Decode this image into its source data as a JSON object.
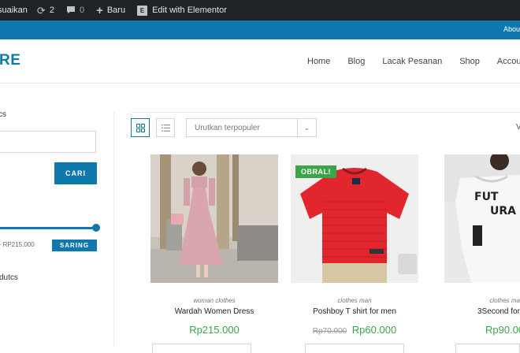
{
  "admin_bar": {
    "customize_label": "suaikan",
    "updates_count": "2",
    "comments_count": "0",
    "new_label": "Baru",
    "elementor_icon_label": "E",
    "elementor_label": "Edit with Elementor"
  },
  "top_bar": {
    "about_label": "Abou"
  },
  "header": {
    "logo_text": "RE",
    "nav": [
      "Home",
      "Blog",
      "Lacak Pesanan",
      "Shop",
      "Account"
    ]
  },
  "sidebar": {
    "search_title": "cs",
    "search_button": "CARI",
    "price_range": "– RP215.000",
    "filter_button": "SARING",
    "categories_title": "dutcs"
  },
  "toolbar": {
    "sort_selected": "Urutkan terpopuler",
    "view_label": "V"
  },
  "products": [
    {
      "category": "woman clothes",
      "name": "Wardah Women Dress",
      "price": "Rp215.000",
      "old_price": "",
      "badge": ""
    },
    {
      "category": "clothes man",
      "name": "Poshboy T shirt for men",
      "price": "Rp60.000",
      "old_price": "Rp70.000",
      "badge": "OBRAL!"
    },
    {
      "category": "clothes ma",
      "name": "3Second for",
      "price": "Rp90.00",
      "old_price": "",
      "badge": ""
    }
  ],
  "colors": {
    "brand": "#0f79ae",
    "admin_bar": "#1d2327",
    "price": "#3ba548",
    "sale_badge": "#3ba548"
  },
  "shirt_text": {
    "print_line1": "FUT",
    "print_line2": "URA"
  }
}
